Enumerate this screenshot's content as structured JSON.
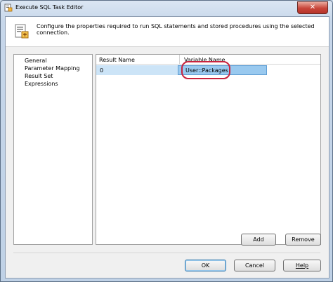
{
  "window": {
    "title": "Execute SQL Task Editor",
    "close_glyph": "✕"
  },
  "header": {
    "description": "Configure the properties required to run SQL statements and stored procedures using the selected connection."
  },
  "nav": {
    "items": [
      "General",
      "Parameter Mapping",
      "Result Set",
      "Expressions"
    ]
  },
  "grid": {
    "columns": [
      "Result Name",
      "Variable Name"
    ],
    "rows": [
      {
        "result_name": "0",
        "variable_name": "User::Packages"
      }
    ]
  },
  "buttons": {
    "add": "Add",
    "remove": "Remove",
    "ok": "OK",
    "cancel": "Cancel",
    "help": "Help"
  },
  "colors": {
    "highlight_oval": "#c8233f",
    "selected_row": "#cce4f7",
    "close_button": "#c8453a"
  },
  "icons": {
    "title": "sql-task-icon",
    "header": "sql-document-icon"
  }
}
